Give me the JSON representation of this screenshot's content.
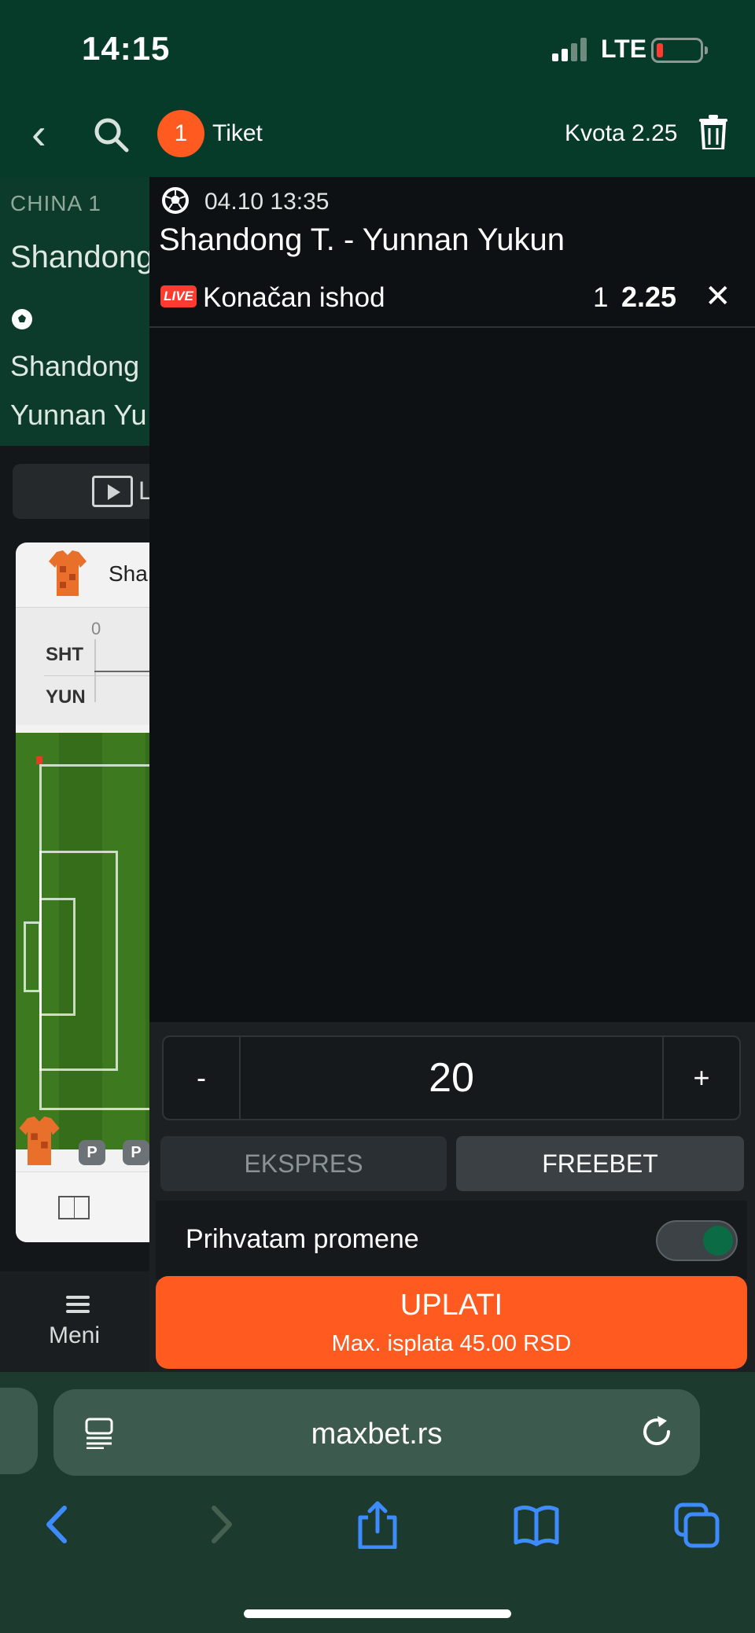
{
  "status_bar": {
    "time": "14:15",
    "network": "LTE"
  },
  "background_page": {
    "league": "CHINA 1",
    "match_partial": "Shandong",
    "team1_partial": "Shandong",
    "team2_partial": "Yunnan Yu",
    "live_btn_partial": "L",
    "card_team_partial": "Sha",
    "score_zero": "0",
    "team1_abbr": "SHT",
    "team2_abbr": "YUN",
    "badge1": "P",
    "badge2": "P",
    "menu_label": "Meni"
  },
  "slip": {
    "count": "1",
    "title": "Tiket",
    "kvota_label": "Kvota 2.25",
    "match_datetime": "04.10 13:35",
    "match_name": "Shandong T. - Yunnan Yukun",
    "live_badge": "LIVE",
    "market": "Konačan ishod",
    "pick": "1",
    "odds": "2.25",
    "stake": {
      "minus": "-",
      "value": "20",
      "plus": "+"
    },
    "types": [
      "EKSPRES",
      "FREEBET"
    ],
    "accept_changes": "Prihvatam promene",
    "accept_on": true,
    "pay_label": "UPLATI",
    "max_payout": "Max. isplata  45.00 RSD"
  },
  "browser": {
    "url": "maxbet.rs"
  },
  "colors": {
    "header_green": "#063b2a",
    "accent_orange": "#ff5a1f",
    "live_red": "#ff3b30",
    "toggle_green": "#0b6b45",
    "ios_blue": "#3d8bff"
  }
}
